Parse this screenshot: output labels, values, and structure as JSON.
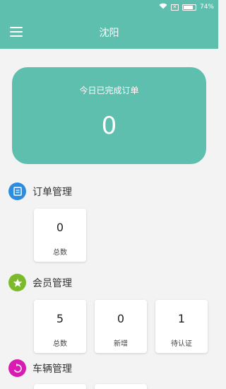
{
  "status_bar": {
    "battery": "74%"
  },
  "header": {
    "title": "沈阳"
  },
  "today_card": {
    "label": "今日已完成订单",
    "value": "0"
  },
  "sections": {
    "orders": {
      "title": "订单管理",
      "tiles": [
        {
          "value": "0",
          "label": "总数"
        }
      ]
    },
    "members": {
      "title": "会员管理",
      "tiles": [
        {
          "value": "5",
          "label": "总数"
        },
        {
          "value": "0",
          "label": "新增"
        },
        {
          "value": "1",
          "label": "待认证"
        }
      ]
    },
    "vehicles": {
      "title": "车辆管理"
    }
  }
}
